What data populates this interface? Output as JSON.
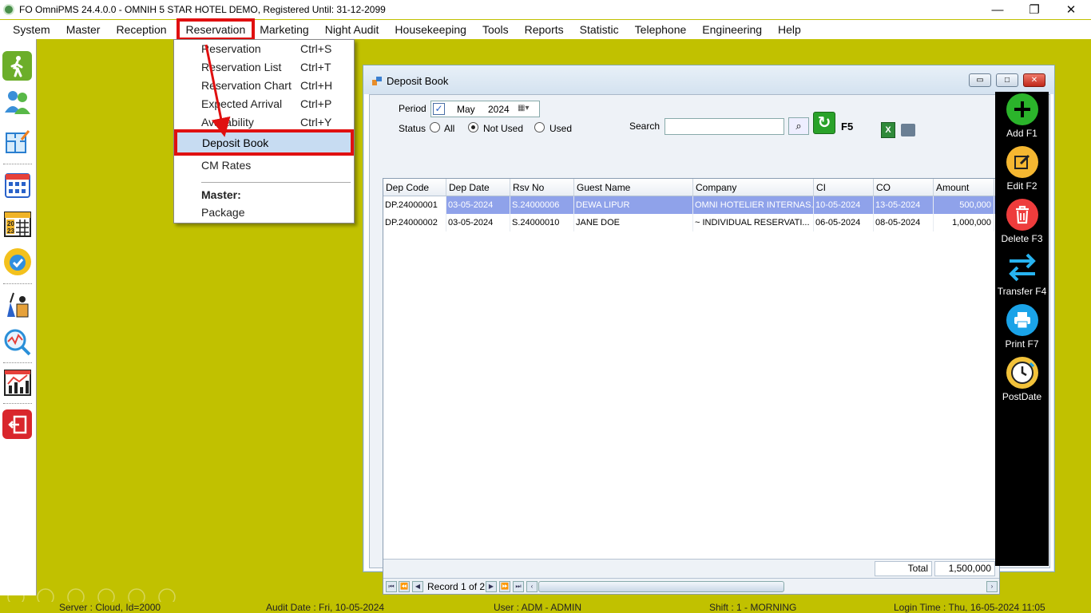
{
  "window": {
    "title": "FO OmniPMS 24.4.0.0 - OMNIH 5 STAR HOTEL DEMO, Registered Until: 31-12-2099",
    "minimize": "—",
    "restore": "❐",
    "close": "✕"
  },
  "menu": [
    "System",
    "Master",
    "Reception",
    "Reservation",
    "Marketing",
    "Night Audit",
    "Housekeeping",
    "Tools",
    "Reports",
    "Statistic",
    "Telephone",
    "Engineering",
    "Help"
  ],
  "dropdown": {
    "items": [
      {
        "label": "Reservation",
        "shortcut": "Ctrl+S"
      },
      {
        "label": "Reservation List",
        "shortcut": "Ctrl+T"
      },
      {
        "label": "Reservation Chart",
        "shortcut": "Ctrl+H"
      },
      {
        "label": "Expected Arrival",
        "shortcut": "Ctrl+P"
      },
      {
        "label": "Availability",
        "shortcut": "Ctrl+Y"
      }
    ],
    "highlighted": "Deposit Book",
    "cm_rates": "CM Rates",
    "master_header": "Master:",
    "package": "Package"
  },
  "deposit_window": {
    "title": "Deposit Book",
    "period_label": "Period",
    "period_month": "May",
    "period_year": "2024",
    "status_label": "Status",
    "status_options": [
      "All",
      "Not Used",
      "Used"
    ],
    "status_selected": "Not Used",
    "search_label": "Search",
    "search_value": "",
    "refresh_key": "F5",
    "columns": [
      "Dep Code",
      "Dep Date",
      "Rsv No",
      "Guest Name",
      "Company",
      "CI",
      "CO",
      "Amount"
    ],
    "rows": [
      [
        "DP.24000001",
        "03-05-2024",
        "S.24000006",
        "DEWA LIPUR",
        "OMNI HOTELIER INTERNAS...",
        "10-05-2024",
        "13-05-2024",
        "500,000"
      ],
      [
        "DP.24000002",
        "03-05-2024",
        "S.24000010",
        "JANE DOE",
        "~ INDIVIDUAL RESERVATI...",
        "06-05-2024",
        "08-05-2024",
        "1,000,000"
      ]
    ],
    "total_label": "Total",
    "total_value": "1,500,000",
    "record_text": "Record 1 of 2",
    "actions": [
      {
        "label": "Add F1",
        "color": "#2bb42b"
      },
      {
        "label": "Edit F2",
        "color": "#f5b731"
      },
      {
        "label": "Delete F3",
        "color": "#ee3c3c"
      },
      {
        "label": "Transfer F4",
        "color": "#27b3f0"
      },
      {
        "label": "Print F7",
        "color": "#1aa3e8"
      },
      {
        "label": "PostDate",
        "color": "#f2c23a"
      }
    ]
  },
  "status_bar": {
    "server": "Server : Cloud, Id=2000",
    "audit_date": "Audit Date : Fri, 10-05-2024",
    "user": "User : ADM - ADMIN",
    "shift": "Shift : 1 - MORNING",
    "login_time": "Login Time : Thu, 16-05-2024 11:05"
  }
}
